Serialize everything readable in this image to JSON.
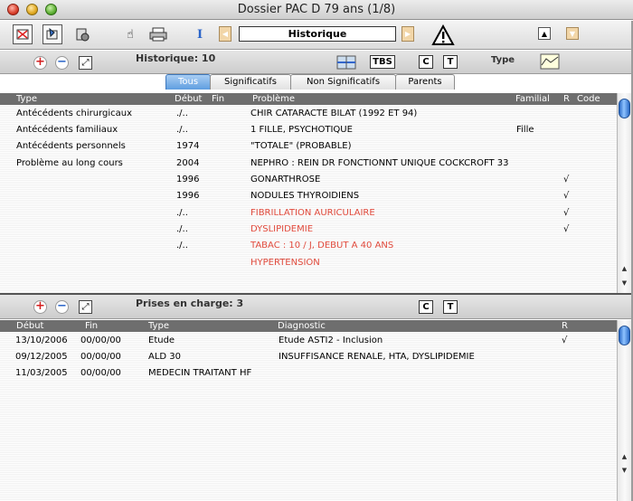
{
  "window": {
    "title": "Dossier PAC D 79 ans (1/8)"
  },
  "toolbar": {
    "historique_field": "Historique",
    "icons": [
      "patient-card-icon",
      "folder-hand-icon",
      "gear-doc-icon",
      "hand-pointer-icon",
      "printer-icon",
      "text-cursor-icon",
      "prev-arrow-icon",
      "next-arrow-icon",
      "warning-icon",
      "up-arrow-icon",
      "down-arrow-icon"
    ]
  },
  "historique_bar": {
    "label": "Historique: 10",
    "tbs_label": "TBS",
    "c_label": "C",
    "t_label": "T",
    "type_label": "Type"
  },
  "tabs": [
    {
      "label": "Tous",
      "active": true
    },
    {
      "label": "Significatifs",
      "active": false
    },
    {
      "label": "Non Significatifs",
      "active": false
    },
    {
      "label": "Parents",
      "active": false
    }
  ],
  "history_table": {
    "headers": {
      "type": "Type",
      "debut": "Début",
      "fin": "Fin",
      "probleme": "Problème",
      "familial": "Familial",
      "r": "R",
      "code": "Code"
    },
    "rows": [
      {
        "type": "Antécédents chirurgicaux",
        "debut": "./..",
        "probleme": "CHIR CATARACTE BILAT (1992 ET 94)",
        "familial": "",
        "r": "",
        "red": false
      },
      {
        "type": "Antécédents familiaux",
        "debut": "./..",
        "probleme": "1 FILLE, PSYCHOTIQUE",
        "familial": "Fille",
        "r": "",
        "red": false
      },
      {
        "type": "Antécédents personnels",
        "debut": "1974",
        "probleme": "\"TOTALE\" (PROBABLE)",
        "familial": "",
        "r": "",
        "red": false
      },
      {
        "type": "Problème au long cours",
        "debut": "2004",
        "probleme": "NEPHRO : REIN DR FONCTIONNT UNIQUE COCKCROFT 33",
        "familial": "",
        "r": "",
        "red": false
      },
      {
        "type": "",
        "debut": "1996",
        "probleme": "GONARTHROSE",
        "familial": "",
        "r": "√",
        "red": false
      },
      {
        "type": "",
        "debut": "1996",
        "probleme": "NODULES THYROIDIENS",
        "familial": "",
        "r": "√",
        "red": false
      },
      {
        "type": "",
        "debut": "./..",
        "probleme": "FIBRILLATION AURICULAIRE",
        "familial": "",
        "r": "√",
        "red": true
      },
      {
        "type": "",
        "debut": "./..",
        "probleme": "DYSLIPIDEMIE",
        "familial": "",
        "r": "√",
        "red": true
      },
      {
        "type": "",
        "debut": "./..",
        "probleme": "TABAC : 10 / J, DEBUT A 40 ANS",
        "familial": "",
        "r": "",
        "red": true
      },
      {
        "type": "",
        "debut": "",
        "probleme": "HYPERTENSION",
        "familial": "",
        "r": "",
        "red": true
      }
    ]
  },
  "prises_bar": {
    "label": "Prises en charge: 3",
    "c_label": "C",
    "t_label": "T"
  },
  "prises_table": {
    "headers": {
      "debut": "Début",
      "fin": "Fin",
      "type": "Type",
      "diagnostic": "Diagnostic",
      "r": "R"
    },
    "rows": [
      {
        "debut": "13/10/2006",
        "fin": "00/00/00",
        "type": "Etude",
        "diagnostic": "Etude ASTI2 - Inclusion",
        "r": "√"
      },
      {
        "debut": "09/12/2005",
        "fin": "00/00/00",
        "type": "ALD 30",
        "diagnostic": "INSUFFISANCE RENALE, HTA, DYSLIPIDEMIE",
        "r": ""
      },
      {
        "debut": "11/03/2005",
        "fin": "00/00/00",
        "type": "MEDECIN TRAITANT HF",
        "diagnostic": "",
        "r": ""
      }
    ]
  },
  "colors": {
    "red_text": "#e04a3c",
    "header_bg": "#6e6e6e",
    "tab_active": "#5f9de0"
  }
}
